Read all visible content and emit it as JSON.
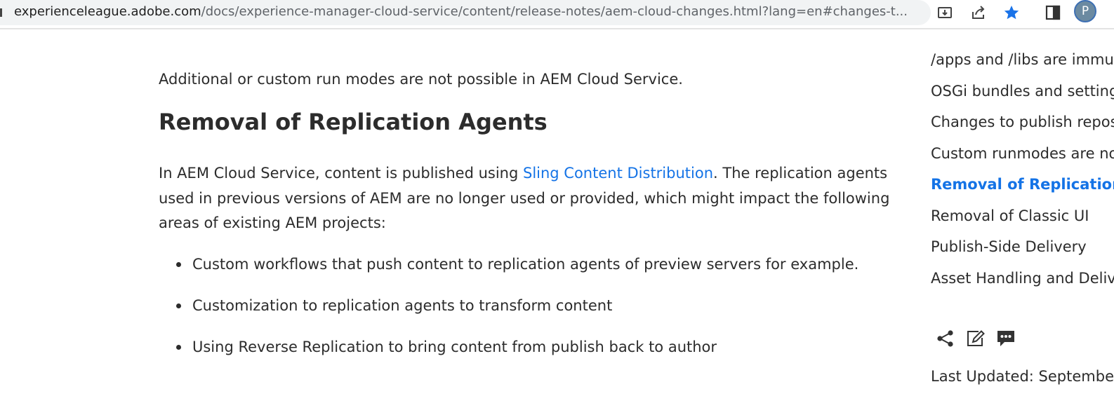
{
  "browser": {
    "url_host": "experienceleague.adobe.com",
    "url_path": "/docs/experience-manager-cloud-service/content/release-notes/aem-cloud-changes.html?lang=en#changes-t...",
    "profile_initial": "P",
    "icons": [
      "install-app-icon",
      "share-icon",
      "bookmark-star-icon",
      "side-panel-icon"
    ],
    "accent_color": "#1a73e8"
  },
  "article": {
    "intro": "Additional or custom run modes are not possible in AEM Cloud Service.",
    "heading": "Removal of Replication Agents",
    "para_before_link": "In AEM Cloud Service, content is published using ",
    "link_text": "Sling Content Distribution",
    "para_after_link": ". The replication agents used in previous versions of AEM are no longer used or provided, which might impact the following areas of existing AEM projects:",
    "bullets": [
      "Custom workflows that push content to replication agents of preview servers for example.",
      "Customization to replication agents to transform content",
      "Using Reverse Replication to bring content from publish back to author"
    ],
    "link_color": "#1473e6"
  },
  "toc": {
    "items": [
      "/apps and /libs are immutable at runtime",
      "OSGi bundles and settings",
      "Changes to publish repository",
      "Custom runmodes are not allowed",
      "Removal of Replication Agents",
      "Removal of Classic UI",
      "Publish-Side Delivery",
      "Asset Handling and Delivery"
    ],
    "active_index": 4,
    "action_icons": [
      "share-icon",
      "edit-icon",
      "feedback-icon"
    ],
    "last_updated": "Last Updated: September"
  }
}
